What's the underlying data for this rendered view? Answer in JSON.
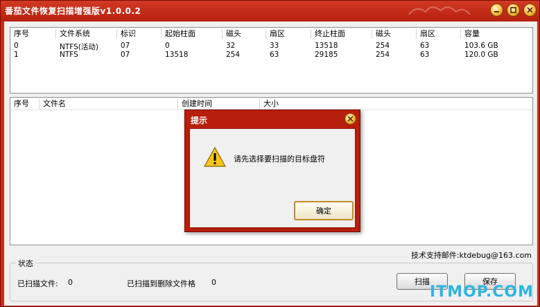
{
  "window": {
    "title": "番茄文件恢复扫描增强版v1.0.0.2"
  },
  "partition_table": {
    "headers": [
      "序号",
      "文件系统",
      "标识",
      "起始柱面",
      "磁头",
      "扇区",
      "终止柱面",
      "磁头",
      "扇区",
      "容量"
    ],
    "rows": [
      [
        "0",
        "NTFS(活动)",
        "07",
        "0",
        "32",
        "33",
        "13518",
        "254",
        "63",
        "103.6 GB"
      ],
      [
        "1",
        "NTFS",
        "07",
        "13518",
        "254",
        "63",
        "29185",
        "254",
        "63",
        "120.0 GB"
      ]
    ]
  },
  "file_table": {
    "headers": [
      "序号",
      "文件名",
      "创建时间",
      "大小"
    ]
  },
  "support": {
    "text": "技术支持邮件:ktdebug@163.com"
  },
  "status": {
    "group_label": "状态",
    "scanned_files_label": "已扫描文件:",
    "scanned_files_value": "0",
    "scanned_deleted_label": "已扫描到删除文件格",
    "scanned_deleted_value": "0"
  },
  "buttons": {
    "scan": "扫描",
    "save": "保存"
  },
  "dialog": {
    "title": "提示",
    "message": "请先选择要扫描的目标盘符",
    "ok": "确定"
  },
  "watermark": "ITMOP.COM",
  "colors": {
    "frame": "#c62d1a",
    "accent_gold": "#f0b430"
  },
  "icons": {
    "minimize": "minimize-icon",
    "maximize": "maximize-icon",
    "close": "close-icon",
    "warning": "warning-icon"
  }
}
